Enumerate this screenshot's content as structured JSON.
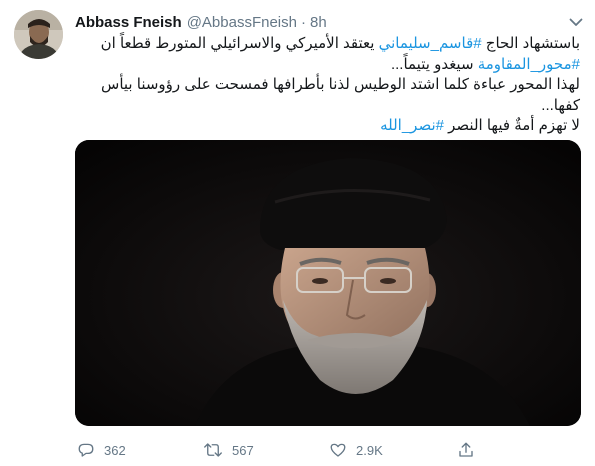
{
  "tweet": {
    "author": {
      "name": "Abbass Fneish",
      "handle": "@AbbassFneish",
      "separator": "·",
      "time": "8h"
    },
    "body": {
      "line1_a": "باستشهاد الحاج ",
      "line1_tag": "#قاسم_سليماني",
      "line1_b": " يعتقد الأميركي والاسرائيلي المتورط قطعاً ان",
      "line2_tag": "#محور_المقاومة",
      "line2_b": " سيغدو يتيماً...",
      "line3": "لهذا المحور عباءة كلما اشتد الوطيس لذنا بأطرافها فمسحت على رؤوسنا بيأس كفها...",
      "line4_a": "لا تهزم أمةٌ فيها النصر ",
      "line4_tag": "#نصر_الله"
    },
    "actions": {
      "replies": "362",
      "retweets": "567",
      "likes": "2.9K"
    },
    "colors": {
      "hashtag": "#1b95e0",
      "muted": "#657786",
      "text": "#14171a"
    },
    "icons": [
      "chevron-down-icon",
      "reply-icon",
      "retweet-icon",
      "like-icon",
      "share-icon"
    ]
  }
}
